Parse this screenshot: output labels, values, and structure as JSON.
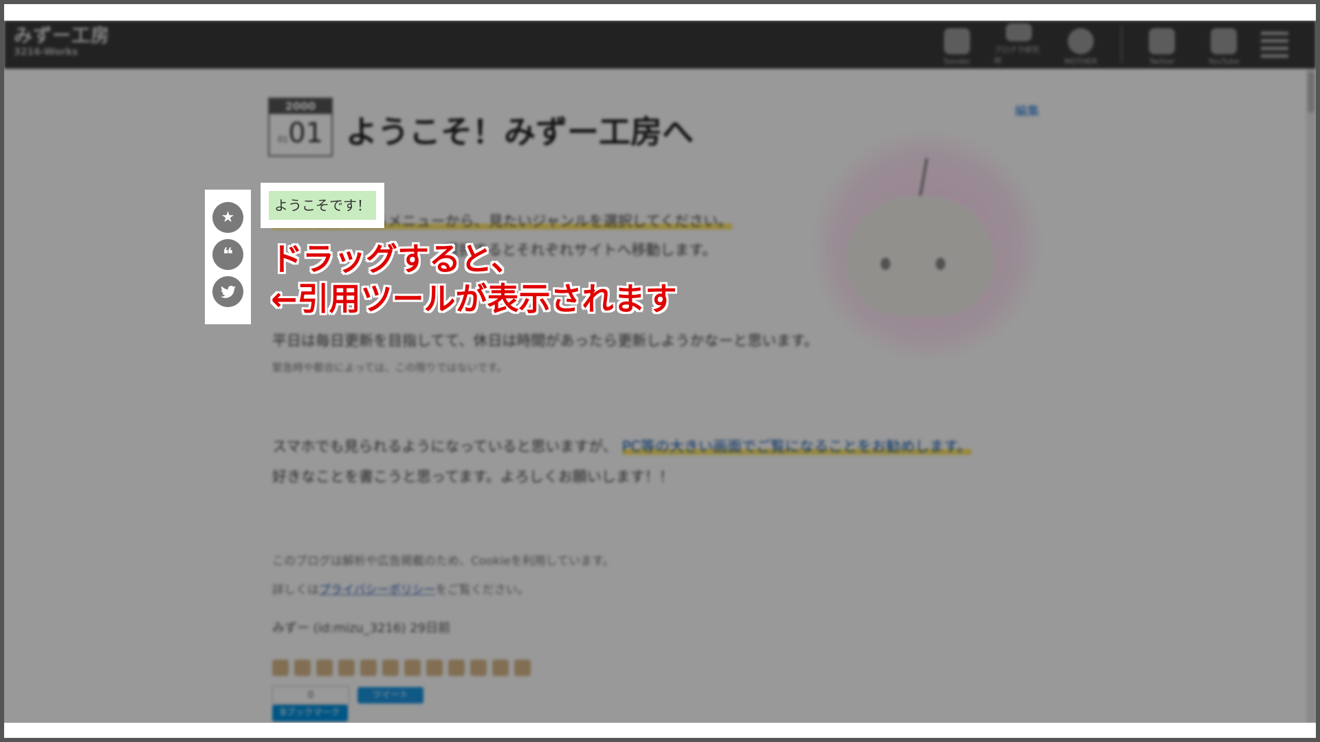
{
  "site": {
    "title": "みずー工房",
    "subtitle": "3216-Works"
  },
  "nav": {
    "items": [
      {
        "label": "Sonder",
        "icon": "sonder-icon"
      },
      {
        "label": "プログラ研究所",
        "icon": "program-icon"
      },
      {
        "label": "MOTHER",
        "icon": "mother-icon"
      },
      {
        "label": "Twitter",
        "icon": "twitter-icon"
      },
      {
        "label": "YouTube",
        "icon": "youtube-icon"
      }
    ]
  },
  "post": {
    "date_year": "2000",
    "date_month": "01",
    "date_day": "01",
    "title": "ようこそ！みずー工房へ",
    "edit_label": "編集",
    "selected_text": "ようこそです！",
    "lines": [
      "ページ上部にあるメニューから、見たいジャンルを選択してください。",
      "選択するとそれぞれサイトへ移動します。",
      "平日は毎日更新を目指してて、休日は時間があったら更新しようかなーと思います。",
      "緊急時や都合によっては、この限りではないです。",
      "スマホでも見られるようになっていると思いますが、",
      "PC等の大きい画面でご覧になることをお勧めします。",
      "好きなことを書こうと思ってます。よろしくお願いします！！",
      "このブログは解析や広告掲載のため、Cookieを利用しています。",
      "詳しくは",
      "プライバシーポリシー",
      "をご覧ください。",
      "みずー (id:mizu_3216) 29日前"
    ],
    "share_count": "0",
    "tweet_label": "ツイート",
    "bookmark_label": "Bブックマーク"
  },
  "toolbar": {
    "buttons": [
      {
        "name": "star",
        "icon": "star-icon",
        "glyph": "★"
      },
      {
        "name": "quote",
        "icon": "quote-icon",
        "glyph": "❝"
      },
      {
        "name": "tweet",
        "icon": "twitter-icon",
        "glyph": "🐦"
      }
    ]
  },
  "annotation": {
    "line1": "ドラッグすると、",
    "line2": "←引用ツールが表示されます"
  }
}
